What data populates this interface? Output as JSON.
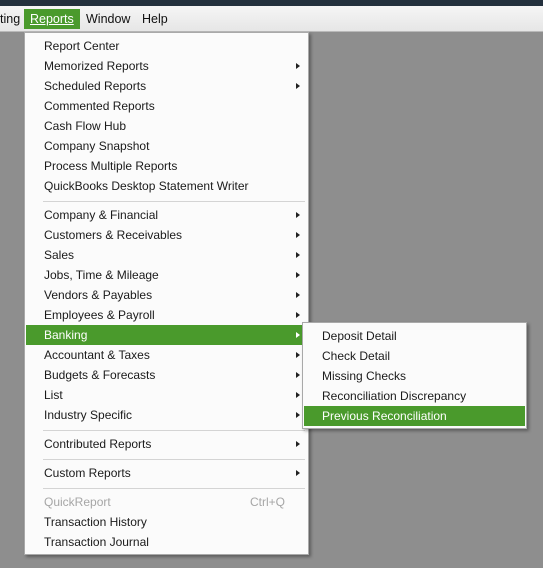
{
  "menubar": {
    "items": [
      {
        "label": "ting"
      },
      {
        "label": "Reports"
      },
      {
        "label": "Window"
      },
      {
        "label": "Help"
      }
    ]
  },
  "reports_menu": {
    "items": [
      {
        "label": "Report Center"
      },
      {
        "label": "Memorized Reports"
      },
      {
        "label": "Scheduled Reports"
      },
      {
        "label": "Commented Reports"
      },
      {
        "label": "Cash Flow Hub"
      },
      {
        "label": "Company Snapshot"
      },
      {
        "label": "Process Multiple Reports"
      },
      {
        "label": "QuickBooks Desktop Statement Writer"
      },
      {
        "label": "Company & Financial"
      },
      {
        "label": "Customers & Receivables"
      },
      {
        "label": "Sales"
      },
      {
        "label": "Jobs, Time & Mileage"
      },
      {
        "label": "Vendors & Payables"
      },
      {
        "label": "Employees & Payroll"
      },
      {
        "label": "Banking"
      },
      {
        "label": "Accountant & Taxes"
      },
      {
        "label": "Budgets & Forecasts"
      },
      {
        "label": "List"
      },
      {
        "label": "Industry Specific"
      },
      {
        "label": "Contributed Reports"
      },
      {
        "label": "Custom Reports"
      },
      {
        "label": "QuickReport",
        "shortcut": "Ctrl+Q"
      },
      {
        "label": "Transaction History"
      },
      {
        "label": "Transaction Journal"
      }
    ]
  },
  "banking_submenu": {
    "items": [
      {
        "label": "Deposit Detail"
      },
      {
        "label": "Check Detail"
      },
      {
        "label": "Missing Checks"
      },
      {
        "label": "Reconciliation Discrepancy"
      },
      {
        "label": "Previous Reconciliation"
      }
    ]
  },
  "colors": {
    "highlight": "#4a9a2c",
    "background": "#8e8e8e",
    "disabled_text": "#a6a6a6"
  }
}
